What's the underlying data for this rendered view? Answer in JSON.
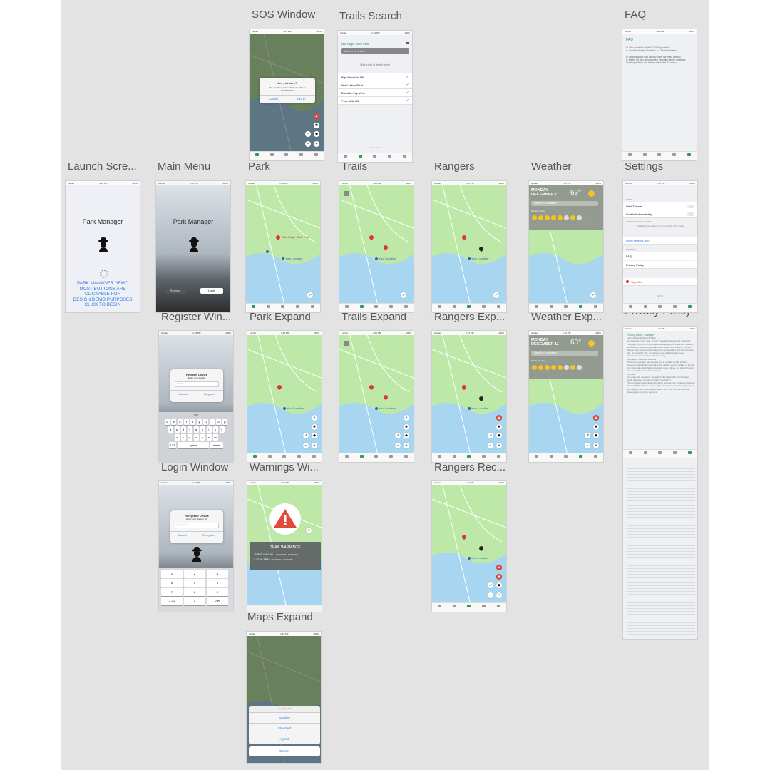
{
  "labels": {
    "sos": "SOS Window",
    "trails_search": "Trails Search",
    "faq": "FAQ",
    "launch": "Launch Scre...",
    "main_menu": "Main Menu",
    "park": "Park",
    "trails": "Trails",
    "rangers": "Rangers",
    "weather": "Weather",
    "settings": "Settings",
    "register": "Register Win...",
    "park_expand": "Park Expand",
    "trails_expand": "Trails Expand",
    "rangers_expand": "Rangers Exp...",
    "weather_expand": "Weather Exp...",
    "privacy": "Privacy Policy",
    "login": "Login Window",
    "warnings": "Warnings Wi...",
    "rangers_rec": "Rangers Rec...",
    "maps_expand": "Maps Expand"
  },
  "status": {
    "carrier": "Carrier",
    "time": "1:24 PM",
    "battery": "100%"
  },
  "app_name": "Park Manager",
  "launch": {
    "demo_text": "PARK MANAGER DEMO\nMOST BUTTONS ARE\nCLICKABLE FOR\nDESIGN DEMO PURPOSES\nCLICK TO BEGIN"
  },
  "main_menu": {
    "register": "Register",
    "login": "Login"
  },
  "sos": {
    "title": "Are you sure?",
    "message": "You are about to broadcast an SOS to EVERYONE!",
    "cancel": "Cancel",
    "help": "HELP!"
  },
  "trails_search": {
    "park": "Bald Eagle State Park",
    "placeholder": "Search for a trail",
    "hint": "Click a trail to view it on the",
    "items": [
      "High Mountain Hill",
      "Dead Man's Peak",
      "Mountain Top View",
      "Three Mile Hill"
    ],
    "end": "End of list"
  },
  "faq": {
    "title": "FAQ",
    "q1": "Q: Who made the ParkGO iOS Application?",
    "a1": "A: Jacob Malarkey, Christian Lou, Zachariah Derez",
    "q2": "Q: What program was used to make the entire design?",
    "a2": "A: Adobe XD was used to make the entire design prototype, including buttons and testing after initial 3D ocean"
  },
  "map": {
    "park_pin": "Bald Eagle State Park",
    "your_location": "Your Location",
    "pin_sub": "Bald Eagle State Park"
  },
  "tabs": [
    "Park",
    "Trails",
    "Rangers",
    "Weather",
    "Settings"
  ],
  "weather": {
    "day": "MONDAY",
    "date": "DECEMBER 11",
    "temp": "63°",
    "search": "Search for a location",
    "section": "Sunday  Today"
  },
  "settings": {
    "theme_header": "THEME",
    "dark_theme": "Dark Theme",
    "switch_auto": "Switch Automatically",
    "notif_header": "NOTIFICATIONS AND ALERTS",
    "notif_msg": "Notifications are disabled. Go to the Settings app to enable.",
    "open_settings": "Open settings app",
    "support_header": "SUPPORT",
    "faq": "FAQ",
    "privacy": "Privacy Policy",
    "sign_out": "Sign Out",
    "version": "APP v1"
  },
  "register": {
    "title": "Register Device",
    "sub": "Enter your details:",
    "field": "Email",
    "cancel": "Cancel",
    "action": "Register",
    "suggest": "The",
    "space": "space",
    "return": "return",
    "nums": "123"
  },
  "keyboard": {
    "row1": [
      "q",
      "w",
      "e",
      "r",
      "t",
      "y",
      "u",
      "i",
      "o",
      "p"
    ],
    "row2": [
      "a",
      "s",
      "d",
      "f",
      "g",
      "h",
      "j",
      "k",
      "l"
    ],
    "row3": [
      "z",
      "x",
      "c",
      "v",
      "b",
      "n",
      "m"
    ]
  },
  "login": {
    "title": "Reregister Device",
    "sub": "Enter your Ranger ID:",
    "field": "Ranger ID",
    "cancel": "Cancel",
    "action": "Reregister",
    "keys": [
      "1",
      "2",
      "3",
      "4",
      "5",
      "6",
      "7",
      "8",
      "9",
      "+ * #",
      "0",
      "⌫"
    ]
  },
  "warnings": {
    "title": "TRAIL WARNINGS",
    "item1": "- THREE MILE HILL",
    "item1_coord": "(40.735234, -77.921169)",
    "item2": "- 5 STAR TRAIL",
    "item2_coord": "(40.735234, -77.921169)"
  },
  "maps_expand": {
    "header": "Select Map Type",
    "options": [
      "Satellite",
      "Standard",
      "Hybrid"
    ],
    "cancel": "Cancel"
  },
  "privacy": {
    "title": "Privacy Policy - Sample",
    "updated": "Last updated: October 3, 2022",
    "p1": "Our Company (\"us\", \"we\", or \"our\") operates the app (the \"Service\"). This page informs you of our policies regarding the collection, use and disclosure of Personal Information we receive from users of the Site.",
    "p2": "We use your Personal Information only for providing and improving the Site. By using the Site, you agree to the collection and use of information in accordance with this policy.",
    "h1": "Information Collection And Use",
    "p3": "While using our Site, we may ask you to provide us with certain personally identifiable information that can be used to contact or identify you. Personally identifiable information may include, but is not limited to your name (\"Personal Information\").",
    "h2": "Log Data",
    "p4": "Like many site operators, we collect information that your browser sends whenever you visit our Site (\"Log Data\").",
    "p5": "This Log Data may include information such as your computer's Internet Protocol (\"IP\") address, browser type, browser version, the pages of our Site that you visit, the time and date of your visit, the time spent on those pages and other statistics."
  },
  "icons": [
    "ranger-hat-icon",
    "map-pin-icon",
    "location-dot-icon",
    "warning-triangle-icon",
    "sos-icon",
    "compass-icon",
    "tent-icon",
    "settings-icon"
  ],
  "colors": {
    "canvas": "#e3e3e3",
    "map_land": "#bde8a8",
    "map_water": "#a8d6f0",
    "pin": "#d93a2f",
    "accent_blue": "#2f7de1",
    "active_tab": "#2e9a5a",
    "warning": "#e04a3a"
  }
}
